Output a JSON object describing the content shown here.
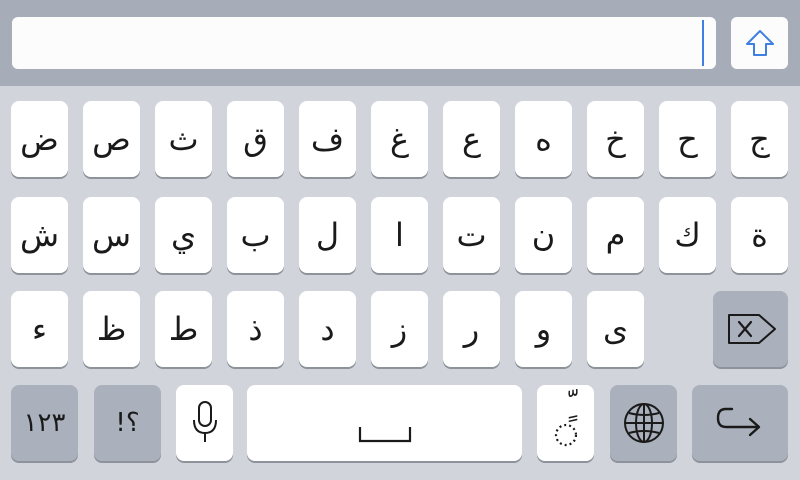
{
  "input": {
    "value": ""
  },
  "keyboard": {
    "row1": [
      "ض",
      "ص",
      "ث",
      "ق",
      "ف",
      "غ",
      "ع",
      "ه",
      "خ",
      "ح",
      "ج"
    ],
    "row2": [
      "ش",
      "س",
      "ي",
      "ب",
      "ل",
      "ا",
      "ت",
      "ن",
      "م",
      "ك",
      "ة"
    ],
    "row3": [
      "ء",
      "ظ",
      "ط",
      "ذ",
      "د",
      "ز",
      "ر",
      "و",
      "ى"
    ],
    "numbers_label": "١٢٣",
    "punct_label": "!؟",
    "diacritic_label": "ٍّ"
  },
  "icons": {
    "shift": "shift-arrow-icon",
    "backspace": "backspace-icon",
    "microphone": "microphone-icon",
    "space": "space-bracket-icon",
    "globe": "globe-icon",
    "return": "return-arrow-icon"
  },
  "colors": {
    "topbar": "#a7adb8",
    "keyboard_bg": "#d1d5db",
    "key": "#ffffff",
    "function_key": "#aab1bc",
    "caret": "#3f7fe0"
  }
}
